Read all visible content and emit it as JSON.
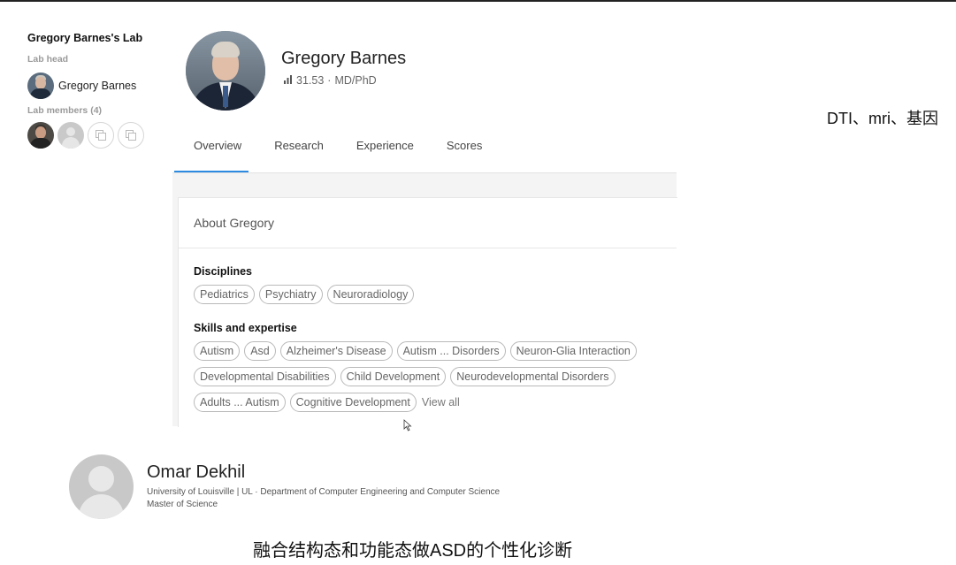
{
  "lab": {
    "title": "Gregory Barnes's Lab",
    "head_label": "Lab head",
    "head_name": "Gregory Barnes",
    "members_label": "Lab members (4)"
  },
  "profile": {
    "name": "Gregory Barnes",
    "score": "31.53",
    "degree_sep": "·",
    "degree": "MD/PhD"
  },
  "tabs": [
    {
      "label": "Overview",
      "active": true
    },
    {
      "label": "Research",
      "active": false
    },
    {
      "label": "Experience",
      "active": false
    },
    {
      "label": "Scores",
      "active": false
    }
  ],
  "about": {
    "title": "About Gregory",
    "disciplines_title": "Disciplines",
    "disciplines": [
      "Pediatrics",
      "Psychiatry",
      "Neuroradiology"
    ],
    "skills_title": "Skills and expertise",
    "skills_row1": [
      "Autism",
      "Asd",
      "Alzheimer's Disease",
      "Autism ... Disorders",
      "Neuron-Glia Interaction"
    ],
    "skills_row2": [
      "Developmental Disabilities",
      "Child Development",
      "Neurodevelopmental Disorders"
    ],
    "skills_row3": [
      "Adults ... Autism",
      "Cognitive Development"
    ],
    "view_all": "View all"
  },
  "note_right": "DTI、mri、基因",
  "second_profile": {
    "name": "Omar Dekhil",
    "affiliation": "University of Louisville | UL · Department of Computer Engineering and Computer Science",
    "degree": "Master of Science"
  },
  "caption": "融合结构态和功能态做ASD的个性化诊断",
  "colors": {
    "accent": "#2c8be0",
    "chip_border": "#b9b9b9",
    "grey_bg": "#f4f4f4"
  },
  "icons": [
    "stats-bars-icon",
    "copy-icon",
    "cursor-icon"
  ]
}
